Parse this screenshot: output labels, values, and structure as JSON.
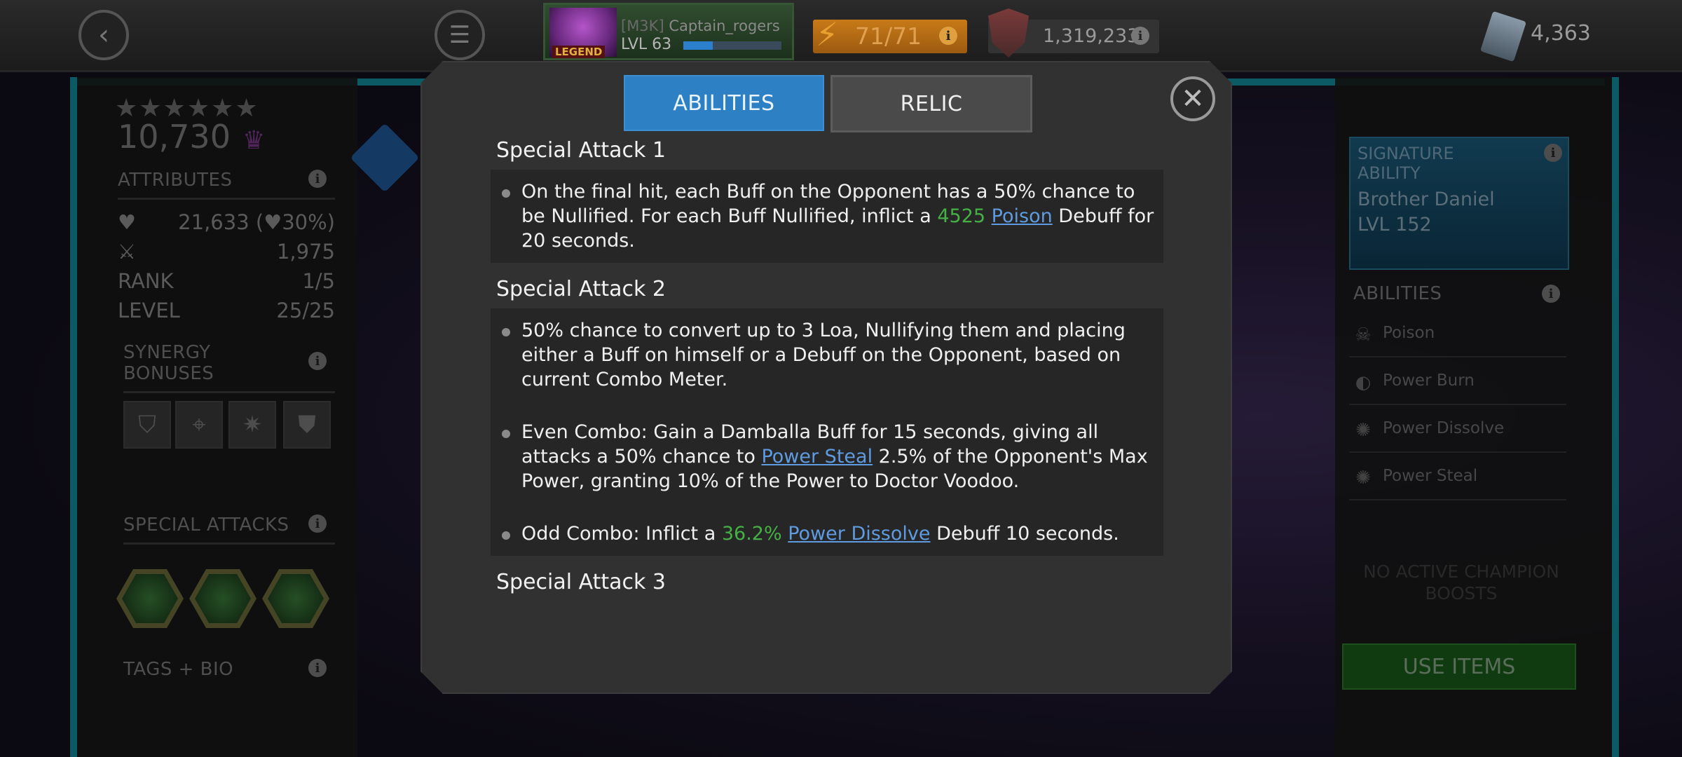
{
  "topbar": {
    "player": {
      "tag": "[M3K]",
      "name": "Captain_rogers",
      "level": "LVL 63",
      "badge": "LEGEND",
      "xp_fraction": 0.3
    },
    "energy": "71/71",
    "rating": "1,319,233",
    "units": "4,363"
  },
  "left_panel": {
    "stars": "★★★★★★",
    "prestige": "10,730",
    "attributes_label": "ATTRIBUTES",
    "health": "21,633",
    "health_pct": "30%",
    "attack": "1,975",
    "rank_label": "RANK",
    "rank": "1/5",
    "level_label": "LEVEL",
    "level": "25/25",
    "synergy_label_1": "SYNERGY",
    "synergy_label_2": "BONUSES",
    "special_attacks_label": "SPECIAL ATTACKS",
    "tags_label": "TAGS + BIO"
  },
  "right_panel": {
    "signature_title_1": "SIGNATURE",
    "signature_title_2": "ABILITY",
    "signature_name": "Brother Daniel",
    "signature_level": "LVL 152",
    "abilities_label": "ABILITIES",
    "abilities": [
      "Poison",
      "Power Burn",
      "Power Dissolve",
      "Power Steal"
    ],
    "no_boosts_1": "NO ACTIVE CHAMPION",
    "no_boosts_2": "BOOSTS",
    "use_items": "USE ITEMS"
  },
  "modal": {
    "tabs": {
      "abilities": "ABILITIES",
      "relic": "RELIC"
    },
    "sa1": {
      "title": "Special Attack 1",
      "text_a": "On the final hit, each Buff on the Opponent has a 50% chance to be Nullified. For each Buff Nullified, inflict a ",
      "num": "4525",
      "link": "Poison",
      "text_b": " Debuff for 20 seconds."
    },
    "sa2": {
      "title": "Special Attack 2",
      "b1": "50% chance to convert up to 3 Loa, Nullifying them and placing either a Buff on himself or a Debuff on the Opponent, based on current Combo Meter.",
      "b2_a": "Even Combo: Gain a Damballa Buff for 15 seconds, giving all attacks a 50% chance to ",
      "b2_link": "Power Steal",
      "b2_b": " 2.5% of the Opponent's Max Power, granting 10% of the Power to Doctor Voodoo.",
      "b3_a": "Odd Combo: Inflict a ",
      "b3_num": "36.2%",
      "b3_link": "Power Dissolve",
      "b3_b": " Debuff 10 seconds."
    },
    "sa3": {
      "title": "Special Attack 3"
    }
  }
}
